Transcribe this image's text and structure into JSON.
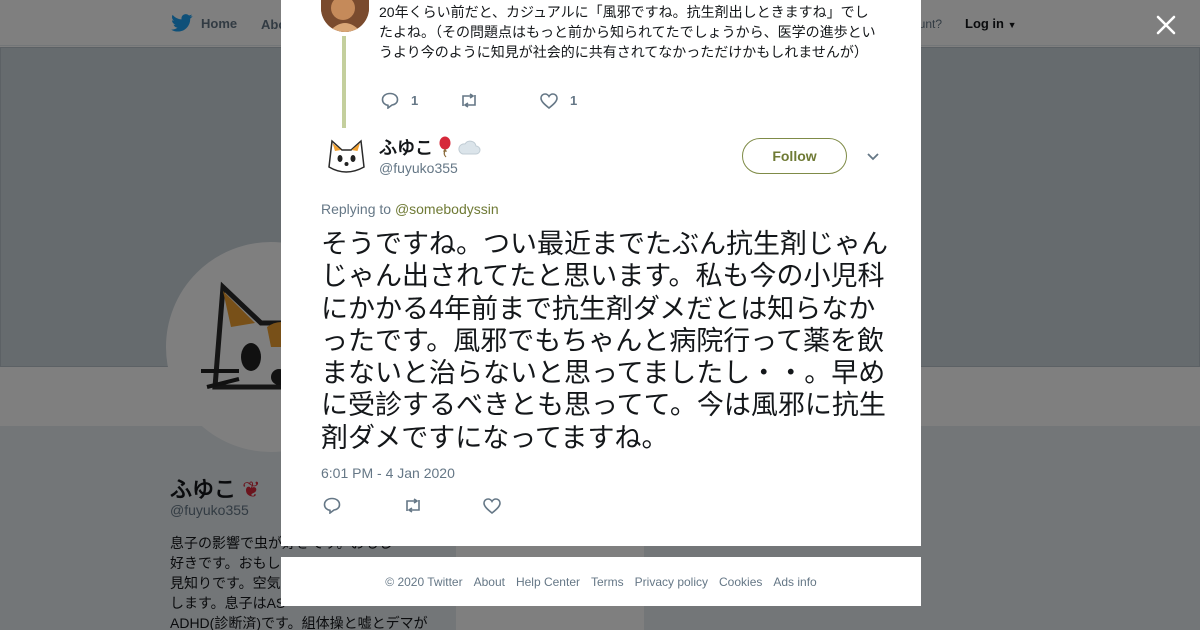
{
  "background": {
    "nav": {
      "home_label": "Home",
      "about_label": "Abo",
      "account_text": "ccount?",
      "login_label": "Log in"
    },
    "profile": {
      "name": "ふゆこ",
      "handle": "@fuyuko355",
      "bio_lines": [
        "息子の影響で虫が好きです。おもし",
        "好きです。おもし",
        "見知りです。空気",
        "します。息子はAS",
        "ADHD(診断済)です。組体操と嘘とデマが"
      ]
    }
  },
  "colors": {
    "accent": "#6f7a35",
    "thread_line": "#c4cf9d",
    "twitter_blue": "#1da1f2",
    "muted": "#657786"
  },
  "previous_tweet": {
    "text": "20年くらい前だと、カジュアルに「風邪ですね。抗生剤出しときますね」でしたよね。（その問題点はもっと前から知られてたでしょうから、医学の進歩というより今のように知見が社会的に共有されてなかっただけかもしれませんが）",
    "reply_count": "1",
    "like_count": "1"
  },
  "tweet": {
    "display_name": "ふゆこ",
    "handle": "@fuyuko355",
    "follow_label": "Follow",
    "replying_prefix": "Replying to",
    "replying_to": "@somebodyssin",
    "text": "そうですね。つい最近までたぶん抗生剤じゃんじゃん出されてたと思います。私も今の小児科にかかる4年前まで抗生剤ダメだとは知らなかったです。風邪でもちゃんと病院行って薬を飲まないと治らないと思ってましたし・・。早めに受診するべきとも思ってて。今は風邪に抗生剤ダメですになってますね。",
    "timestamp": "6:01 PM - 4 Jan 2020"
  },
  "footer": [
    "© 2020 Twitter",
    "About",
    "Help Center",
    "Terms",
    "Privacy policy",
    "Cookies",
    "Ads info"
  ]
}
